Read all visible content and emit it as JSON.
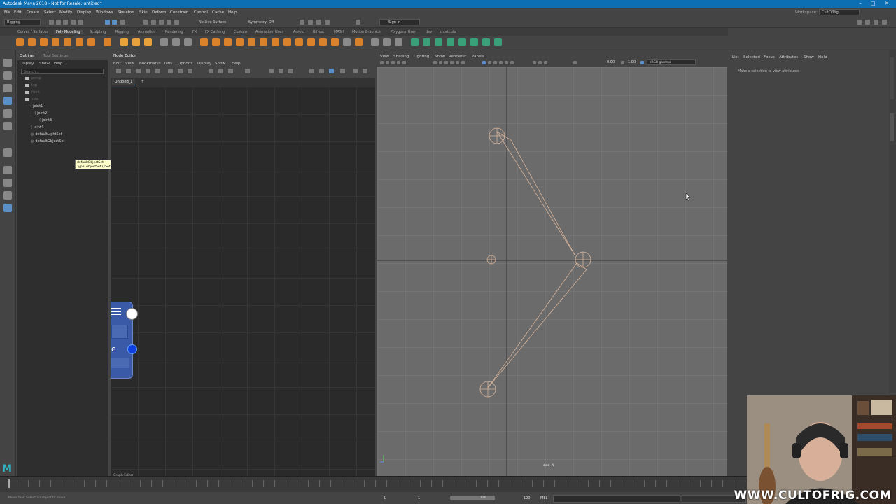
{
  "window": {
    "title": "Autodesk Maya 2018 - Not for Resale: untitled*",
    "controls": [
      "–",
      "□",
      "✕"
    ]
  },
  "menubar": {
    "items": [
      "File",
      "Edit",
      "Create",
      "Select",
      "Modify",
      "Display",
      "Windows",
      "Skeleton",
      "Skin",
      "Deform",
      "Constrain",
      "Control",
      "Cache",
      "Help"
    ],
    "workspace_label": "Workspace:",
    "workspace_value": "CultOfRig"
  },
  "statusline": {
    "menuset": "Rigging",
    "live_surface": "No Live Surface",
    "symmetry": "Symmetry: Off",
    "sign_in": "Sign In"
  },
  "shelf": {
    "tabs": [
      "Curves / Surfaces",
      "Poly Modeling",
      "Sculpting",
      "Rigging",
      "Animation",
      "Rendering",
      "FX",
      "FX Caching",
      "Custom",
      "Animation_User",
      "Arnold",
      "Bifrost",
      "MASH",
      "Motion Graphics",
      "Polygons_User",
      "dev",
      "shortcuts"
    ],
    "active_tab": "Poly Modeling"
  },
  "outliner": {
    "tabs": [
      "Outliner",
      "Tool Settings"
    ],
    "menu": [
      "Display",
      "Show",
      "Help"
    ],
    "search_placeholder": "Search...",
    "rows": [
      {
        "label": "persp",
        "dim": true
      },
      {
        "label": "top",
        "dim": true
      },
      {
        "label": "front",
        "dim": true
      },
      {
        "label": "side",
        "dim": true
      },
      {
        "label": "joint1",
        "dim": false
      },
      {
        "label": "joint2",
        "dim": false
      },
      {
        "label": "joint3",
        "dim": false
      },
      {
        "label": "joint4",
        "dim": false
      },
      {
        "label": "defaultLightSet",
        "dim": false
      },
      {
        "label": "defaultObjectSet",
        "dim": false
      }
    ],
    "tooltip_line1": "defaultObjectSet",
    "tooltip_line2": "Type: objectSet (kSet)"
  },
  "node_editor": {
    "title": "Node Editor",
    "menu": [
      "Edit",
      "View",
      "Bookmarks",
      "Tabs",
      "Options",
      "Display",
      "Show",
      "Help"
    ],
    "tab": "Untitled_1",
    "add_tab": "+",
    "node_letter": "e"
  },
  "viewport": {
    "menu": [
      "View",
      "Shading",
      "Lighting",
      "Show",
      "Renderer",
      "Panels"
    ],
    "field1": "0.00",
    "field2": "1.00",
    "color_space": "sRGB gamma",
    "camera_label": "side -X"
  },
  "attribute_editor": {
    "menu": [
      "List",
      "Selected",
      "Focus",
      "Attributes",
      "Show",
      "Help"
    ],
    "hint": "Make a selection to view attributes"
  },
  "timeline": {
    "graph_editor_tab": "Graph Editor",
    "range_start": "1",
    "range_inner_start": "1",
    "range_inner_end": "120",
    "range_end": "120",
    "range_end2": "120",
    "script_lang": "MEL",
    "help_line": "Move Tool: Select an object to move."
  },
  "watermark": "WWW.CULTOFRIG.COM"
}
